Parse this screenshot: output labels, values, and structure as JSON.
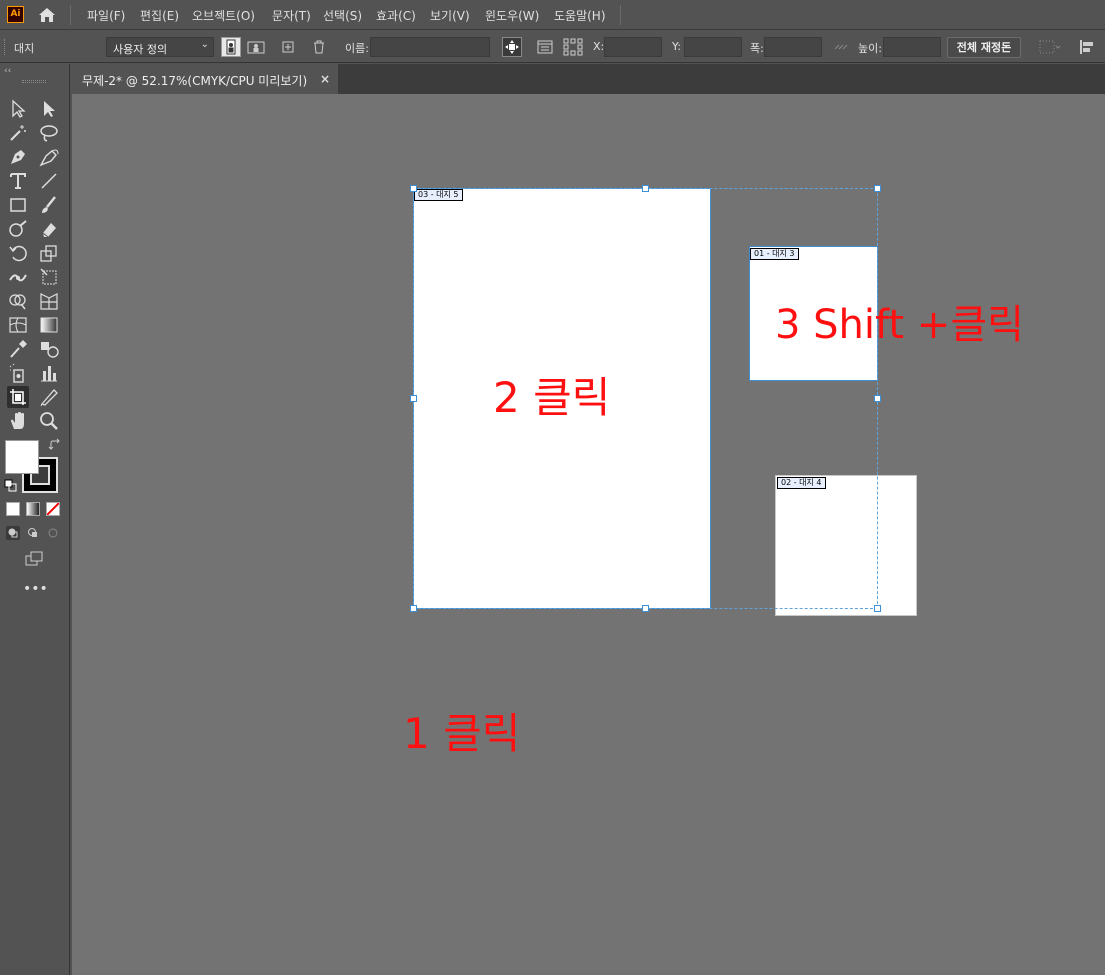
{
  "app": {
    "logo_text": "Ai"
  },
  "menu": [
    "파일(F)",
    "편집(E)",
    "오브젝트(O)",
    "문자(T)",
    "선택(S)",
    "효과(C)",
    "보기(V)",
    "윈도우(W)",
    "도움말(H)"
  ],
  "control_bar": {
    "context_label": "대지",
    "preset_value": "사용자 정의",
    "name_label": "이름:",
    "name_value": "",
    "x_label": "X:",
    "y_label": "Y:",
    "width_label": "폭:",
    "height_label": "높이:",
    "reset_all_label": "전체 재정돈"
  },
  "document_tab": {
    "title": "무제-2* @ 52.17%(CMYK/CPU 미리보기)",
    "close_glyph": "×"
  },
  "artboards": [
    {
      "label": "03 - 대지 5"
    },
    {
      "label": "01 - 대지 3"
    },
    {
      "label": "02 - 대지 4"
    }
  ],
  "annotations": {
    "step1": "1 클릭",
    "step2": "2 클릭",
    "step3": "3 Shift +클릭"
  },
  "colors": {
    "accent": "#3d8fd6",
    "annotation": "#ff1010",
    "canvas": "#737373",
    "chrome": "#535353"
  }
}
